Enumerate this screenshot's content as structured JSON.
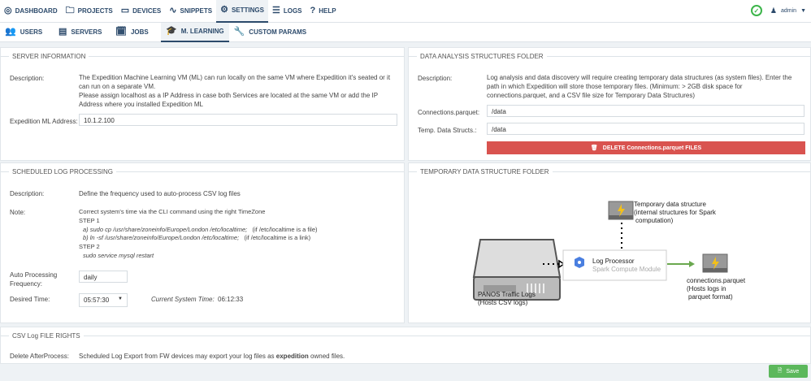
{
  "nav": {
    "items": [
      {
        "label": "DASHBOARD",
        "icon": "compass-icon"
      },
      {
        "label": "PROJECTS",
        "icon": "folder-icon"
      },
      {
        "label": "DEVICES",
        "icon": "laptop-icon"
      },
      {
        "label": "SNIPPETS",
        "icon": "rss-icon"
      },
      {
        "label": "SETTINGS",
        "icon": "gear-icon"
      },
      {
        "label": "LOGS",
        "icon": "list-icon"
      },
      {
        "label": "HELP",
        "icon": "question-icon"
      }
    ],
    "active": "SETTINGS",
    "user": "admin"
  },
  "subnav": {
    "items": [
      {
        "label": "USERS"
      },
      {
        "label": "SERVERS"
      },
      {
        "label": "JOBS"
      },
      {
        "label": "M. LEARNING"
      },
      {
        "label": "CUSTOM PARAMS"
      }
    ],
    "active": "M. LEARNING"
  },
  "server": {
    "title": "SERVER INFORMATION",
    "desc_label": "Description:",
    "desc1": "The Expedition Machine Learning VM (ML) can run locally on the same VM where Expedition it's seated or it can run on a separate VM.",
    "desc2": "Please assign localhost as a IP Address in case both Services are located at the same VM or add the IP Address where you installed Expedition ML",
    "addr_label": "Expedition ML Address:",
    "addr_value": "10.1.2.100"
  },
  "data_folder": {
    "title": "DATA ANALYSIS STRUCTURES FOLDER",
    "desc_label": "Description:",
    "desc": "Log analysis and data discovery will require creating temporary data structures (as system files). Enter the path in which Expedition will store those temporary files. (Minimum: > 2GB disk space for connections.parquet, and a CSV file size for Temporary Data Structures)",
    "conn_label": "Connections.parquet:",
    "conn_value": "/data",
    "temp_label": "Temp. Data Structs.:",
    "temp_value": "/data",
    "delete_label": "DELETE Connections.parquet FILES"
  },
  "scheduled": {
    "title": "SCHEDULED LOG PROCESSING",
    "desc_label": "Description:",
    "desc": "Define the frequency used to auto-process CSV log files",
    "note_label": "Note:",
    "note1": "Correct system's time via the CLI command using the right TimeZone",
    "step1": "STEP 1",
    "step1a": "a) sudo cp /usr/share/zoneinfo/Europe/London /etc/localtime;",
    "step1a_note": "(if /etc/localtime is a file)",
    "step1b": "b) ln -sf /usr/share/zoneinfo/Europe/London /etc/localtime;",
    "step1b_note": "(if /etc/localtime is a link)",
    "step2": "STEP 2",
    "step2a": "sudo service mysql restart",
    "freq_label": "Auto Processing Frequency:",
    "freq_value": "daily",
    "time_label": "Desired Time:",
    "time_value": "05:57:30",
    "cur_label": "Current System Time:",
    "cur_value": "06:12:33"
  },
  "temp_folder": {
    "title": "TEMPORARY DATA STRUCTURE FOLDER",
    "temp_ds": "Temporary data structure",
    "temp_ds2": "(internal structures for Spark",
    "temp_ds3": "computation)",
    "processor": "Log Processor",
    "processor_sub": "Spark Compute Module",
    "panos": "PANOS Traffic Logs",
    "panos2": "(Hosts CSV logs)",
    "conn": "connections.parquet",
    "conn2": "(Hosts logs in",
    "conn3": "parquet format)"
  },
  "csv_rights": {
    "title": "CSV Log FILE RIGHTS",
    "label": "Delete AfterProcess:",
    "text_before": "Scheduled Log Export from FW devices may export your log files as ",
    "text_bold": "expedition",
    "text_after": " owned files."
  },
  "footer": {
    "save_label": "Save"
  }
}
